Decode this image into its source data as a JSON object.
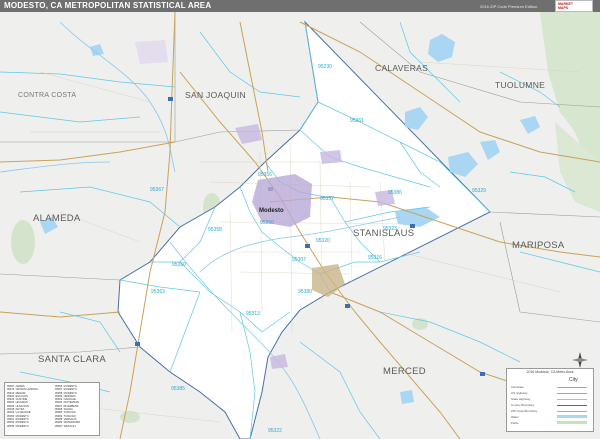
{
  "title": "MODESTO, CA METROPOLITAN STATISTICAL AREA",
  "edition_note": "2016 ZIP Code Premium Edition",
  "publisher_text": [
    "MARKET",
    "MAPS",
    "Online.com"
  ],
  "colors": {
    "title_bar": "#6f6f6f",
    "zip_boundary": "#5ec8e8",
    "county_boundary": "#4a6fa8",
    "metro_fill": "#ffffff",
    "outside_fill": "#efefed",
    "water": "#a9d6f2",
    "parks": "#c9dfc0",
    "highway": "#c7a35a",
    "urban": "#b8a9d6"
  },
  "counties": [
    {
      "name": "SAN JOAQUIN"
    },
    {
      "name": "CALAVERAS"
    },
    {
      "name": "TUOLUMNE"
    },
    {
      "name": "CONTRA COSTA"
    },
    {
      "name": "ALAMEDA"
    },
    {
      "name": "STANISLAUS"
    },
    {
      "name": "MARIPOSA"
    },
    {
      "name": "SANTA CLARA"
    },
    {
      "name": "MERCED"
    }
  ],
  "main_city": "Modesto",
  "zip_codes": [
    "95230",
    "95361",
    "95386",
    "95357",
    "95329",
    "95356",
    "95350",
    "95358",
    "95323",
    "95367",
    "95320",
    "95316",
    "95380",
    "95307",
    "95363",
    "95313",
    "95360",
    "95322",
    "95385"
  ],
  "legend": {
    "title": "2016 Modesto, CA Metro Area",
    "rows": [
      "Interstate",
      "US Highway",
      "State Highway",
      "County Boundary",
      "ZIP Code Boundary",
      "Water",
      "Parks"
    ],
    "city_label": "City"
  },
  "zip_table": {
    "rows": [
      [
        "95307",
        "CERES"
      ],
      [
        "95313",
        "CROWS LANDING"
      ],
      [
        "95316",
        "DENAIR"
      ],
      [
        "95320",
        "ESCALON"
      ],
      [
        "95322",
        "GUSTINE"
      ],
      [
        "95323",
        "HICKMAN"
      ],
      [
        "95326",
        "HUGHSON"
      ],
      [
        "95328",
        "KEYES"
      ],
      [
        "95329",
        "LA GRANGE"
      ],
      [
        "95350",
        "MODESTO"
      ],
      [
        "95351",
        "MODESTO"
      ],
      [
        "95354",
        "MODESTO"
      ],
      [
        "95355",
        "MODESTO"
      ],
      [
        "95356",
        "MODESTO"
      ],
      [
        "95357",
        "MODESTO"
      ],
      [
        "95358",
        "MODESTO"
      ],
      [
        "95360",
        "NEWMAN"
      ],
      [
        "95361",
        "OAKDALE"
      ],
      [
        "95363",
        "PATTERSON"
      ],
      [
        "95367",
        "RIVERBANK"
      ],
      [
        "95368",
        "SALIDA"
      ],
      [
        "95380",
        "TURLOCK"
      ],
      [
        "95382",
        "TURLOCK"
      ],
      [
        "95385",
        "VERNALIS"
      ],
      [
        "95386",
        "WATERFORD"
      ],
      [
        "95387",
        "WESTLEY"
      ]
    ]
  }
}
